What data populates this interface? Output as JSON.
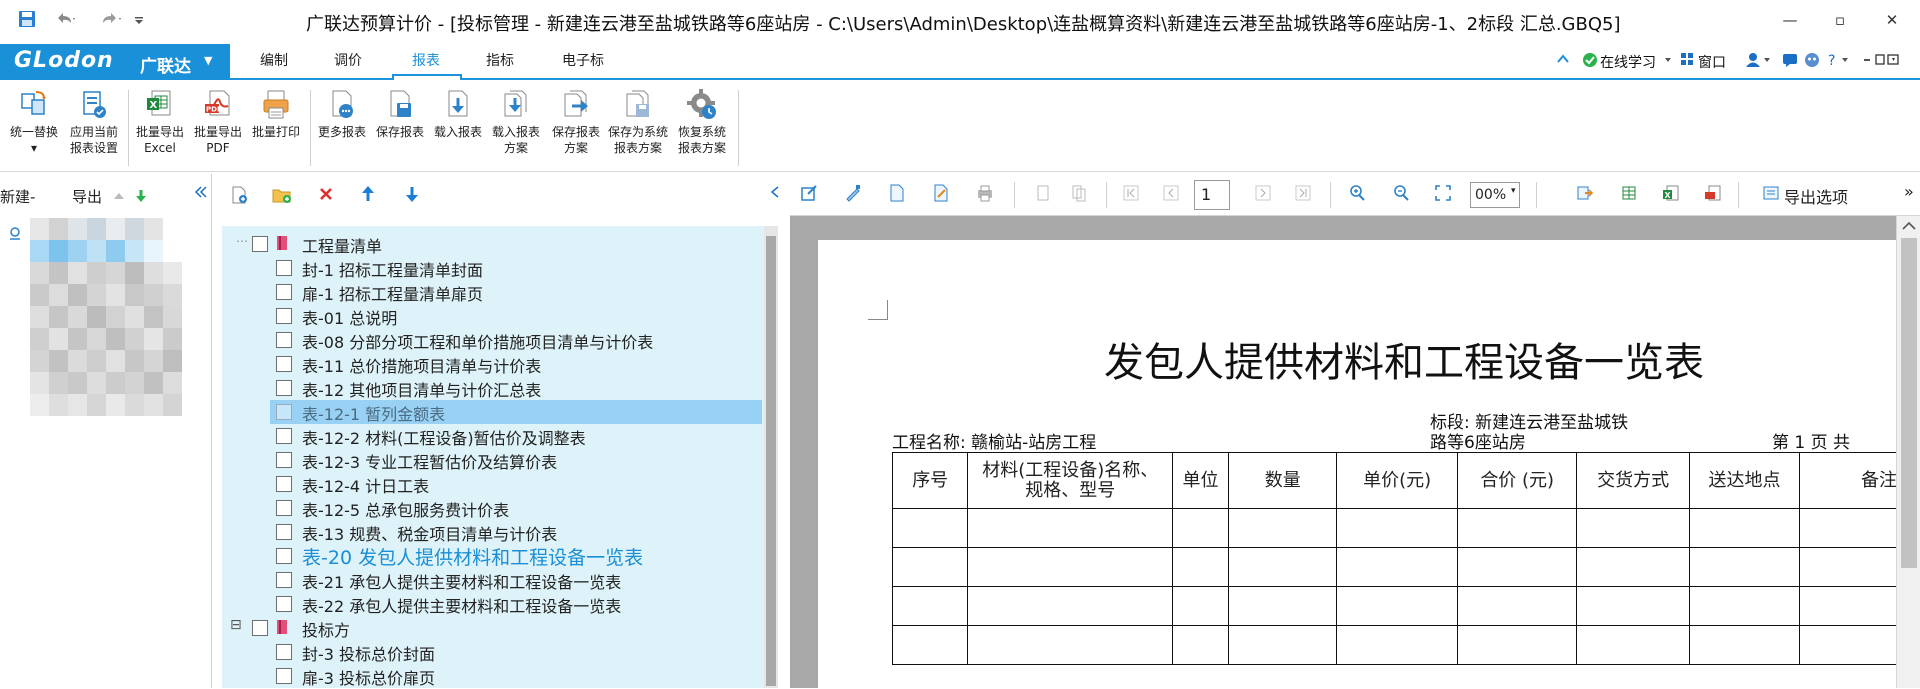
{
  "window": {
    "title": "广联达预算计价 - [投标管理 - 新建连云港至盐城铁路等6座站房 - C:\\Users\\Admin\\Desktop\\连盐概算资料\\新建连云港至盐城铁路等6座站房-1、2标段 汇总.GBQ5]",
    "minimize": "—",
    "restore": "▫",
    "close": "✕"
  },
  "brand": {
    "logo": "GLodon",
    "name": "广联达",
    "caret": "▼"
  },
  "ribbon_tabs": [
    {
      "label": "编制"
    },
    {
      "label": "调价"
    },
    {
      "label": "报表",
      "active": true
    },
    {
      "label": "指标"
    },
    {
      "label": "电子标"
    }
  ],
  "top_right": {
    "online": "在线学习",
    "window": "窗口"
  },
  "toolbar": {
    "buttons": [
      {
        "label": "统一替换",
        "sub": "▾"
      },
      {
        "label": "应用当前",
        "sub": "报表设置"
      },
      {
        "label": "批量导出",
        "sub": "Excel"
      },
      {
        "label": "批量导出",
        "sub": "PDF"
      },
      {
        "label": "批量打印",
        "sub": ""
      },
      {
        "label": "更多报表",
        "sub": ""
      },
      {
        "label": "保存报表",
        "sub": ""
      },
      {
        "label": "载入报表",
        "sub": ""
      },
      {
        "label": "载入报表",
        "sub": "方案"
      },
      {
        "label": "保存报表",
        "sub": "方案"
      },
      {
        "label": "保存为系统",
        "sub": "报表方案"
      },
      {
        "label": "恢复系统",
        "sub": "报表方案"
      }
    ]
  },
  "left_pane": {
    "new_label": "新建-",
    "export_label": "导出"
  },
  "tree": {
    "groups": [
      {
        "label": "工程量清单",
        "items": [
          "封-1 招标工程量清单封面",
          "扉-1 招标工程量清单扉页",
          "表-01 总说明",
          "表-08 分部分项工程和单价措施项目清单与计价表",
          "表-11 总价措施项目清单与计价表",
          "表-12 其他项目清单与计价汇总表",
          "表-12-1 暂列金额表",
          "表-12-2 材料(工程设备)暂估价及调整表",
          "表-12-3 专业工程暂估价及结算价表",
          "表-12-4 计日工表",
          "表-12-5 总承包服务费计价表",
          "表-13 规费、税金项目清单与计价表",
          "表-20 发包人提供材料和工程设备一览表",
          "表-21 承包人提供主要材料和工程设备一览表",
          "表-22 承包人提供主要材料和工程设备一览表"
        ]
      },
      {
        "label": "投标方",
        "items": [
          "封-3 投标总价封面",
          "扉-3 投标总价扉页"
        ]
      }
    ],
    "selected_index": 6,
    "current_index": 12,
    "expand_symbol": "⊟"
  },
  "preview": {
    "page_number": "1",
    "zoom": "00%",
    "export_options": "导出选项",
    "more": "»",
    "report": {
      "title": "发包人提供材料和工程设备一览表",
      "project_name": "工程名称: 赣榆站-站房工程",
      "section_line1": "标段: 新建连云港至盐城铁",
      "section_line2": "路等6座站房",
      "page_text": "第 1 页  共",
      "headers": [
        "序号",
        "材料(工程设备)名称、规格、型号",
        "单位",
        "数量",
        "单价(元)",
        "合价 (元)",
        "交货方式",
        "送达地点",
        "备注"
      ]
    }
  }
}
